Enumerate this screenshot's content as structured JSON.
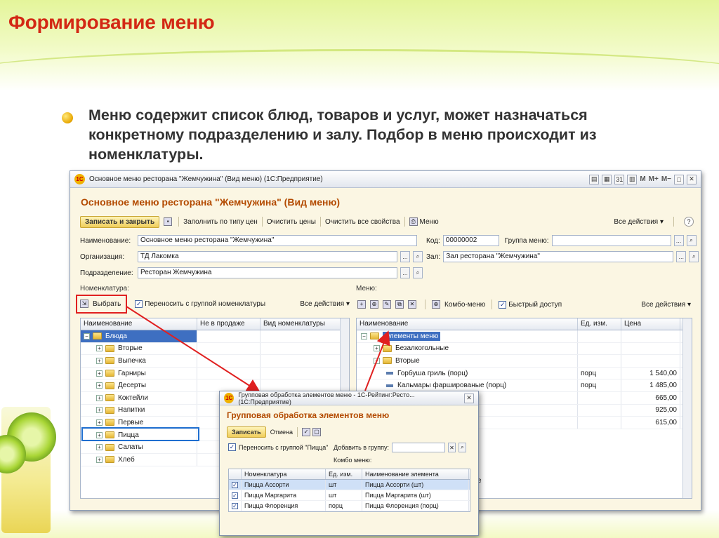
{
  "slide": {
    "title": "Формирование меню",
    "text": "Меню содержит список блюд, товаров и услуг, может назначаться конкретному подразделению и залу. Подбор в меню происходит из номенклатуры."
  },
  "window": {
    "title": "Основное меню ресторана \"Жемчужина\" (Вид меню)  (1С:Предприятие)",
    "logo": "1С",
    "title_buttons": [
      "M",
      "M+",
      "M−"
    ],
    "form_title": "Основное меню ресторана \"Жемчужина\" (Вид меню)",
    "toolbar": {
      "save_close": "Записать и закрыть",
      "fill_by_type": "Заполнить по типу цен",
      "clear_prices": "Очистить цены",
      "clear_props": "Очистить все свойства",
      "menu": "Меню",
      "all_actions": "Все действия ▾",
      "help": "?"
    },
    "fields": {
      "name_label": "Наименование:",
      "name_value": "Основное меню ресторана \"Жемчужина\"",
      "code_label": "Код:",
      "code_value": "00000002",
      "group_label": "Группа меню:",
      "group_value": "",
      "org_label": "Организация:",
      "org_value": "ТД Лакомка",
      "hall_label": "Зал:",
      "hall_value": "Зал ресторана \"Жемчужина\"",
      "dept_label": "Подразделение:",
      "dept_value": "Ресторан Жемчужина"
    },
    "left_pane": {
      "label": "Номенклатура:",
      "select_button": "Выбрать",
      "transfer_label": "Переносить с группой номенклатуры",
      "all_actions": "Все действия ▾",
      "columns": [
        "Наименование",
        "Не в продаже",
        "Вид номенклатуры"
      ],
      "rows": [
        {
          "name": "Блюда",
          "level": 0,
          "toggle": "−",
          "selected": true
        },
        {
          "name": "Вторые",
          "level": 1,
          "toggle": "+"
        },
        {
          "name": "Выпечка",
          "level": 1,
          "toggle": "+"
        },
        {
          "name": "Гарниры",
          "level": 1,
          "toggle": "+"
        },
        {
          "name": "Десерты",
          "level": 1,
          "toggle": "+"
        },
        {
          "name": "Коктейли",
          "level": 1,
          "toggle": "+"
        },
        {
          "name": "Напитки",
          "level": 1,
          "toggle": "+"
        },
        {
          "name": "Первые",
          "level": 1,
          "toggle": "+"
        },
        {
          "name": "Пицца",
          "level": 1,
          "toggle": "+"
        },
        {
          "name": "Салаты",
          "level": 1,
          "toggle": "+"
        },
        {
          "name": "Хлеб",
          "level": 1,
          "toggle": "+"
        }
      ]
    },
    "right_pane": {
      "label": "Меню:",
      "combo_menu": "Комбо-меню",
      "quick_access": "Быстрый доступ",
      "all_actions": "Все действия ▾",
      "columns": [
        "Наименование",
        "Ед. изм.",
        "Цена"
      ],
      "rows": [
        {
          "name": "Элементы меню",
          "type": "folder",
          "level": 0,
          "toggle": "−",
          "unit": "",
          "price": "",
          "selected": true
        },
        {
          "name": "Безалкогольные",
          "type": "folder",
          "level": 1,
          "toggle": "+",
          "unit": "",
          "price": ""
        },
        {
          "name": "Вторые",
          "type": "folder",
          "level": 1,
          "toggle": "−",
          "unit": "",
          "price": ""
        },
        {
          "name": "Горбуша гриль (порц)",
          "type": "item",
          "level": 2,
          "unit": "порц",
          "price": "1 540,00"
        },
        {
          "name": "Кальмары фаршированые (порц)",
          "type": "item",
          "level": 2,
          "unit": "порц",
          "price": "1 485,00"
        },
        {
          "name": "асами (порц)",
          "type": "item",
          "level": 2,
          "unit": "",
          "price": "665,00"
        },
        {
          "name": "",
          "type": "item",
          "level": 2,
          "unit": "",
          "price": "925,00"
        },
        {
          "name": "рц)",
          "type": "item",
          "level": 2,
          "unit": "",
          "price": "615,00"
        }
      ],
      "tail_text": "е"
    },
    "dialog": {
      "title": "Групповая обработка элементов меню - 1С-Рейтинг:Ресто... (1С:Предприятие)",
      "heading": "Групповая обработка элементов меню",
      "save": "Записать",
      "cancel": "Отмена",
      "transfer_label": "Переносить с группой \"Пицца\"",
      "add_to_group": "Добавить в группу:",
      "combo_menu": "Комбо меню:",
      "columns": [
        "Номенклатура",
        "Ед. изм.",
        "Наименование элемента"
      ],
      "rows": [
        {
          "item": "Пицца Ассорти",
          "unit": "шт",
          "name": "Пицца Ассорти (шт)",
          "selected": true
        },
        {
          "item": "Пицца Маргарита",
          "unit": "шт",
          "name": "Пицца Маргарита (шт)"
        },
        {
          "item": "Пицца Флоренция",
          "unit": "порц",
          "name": "Пицца Флоренция (порц)"
        }
      ]
    }
  },
  "colors": {
    "title_red": "#d32814",
    "form_title": "#b34a00",
    "selection": "#3e6fc1",
    "highlight_red": "#e02020",
    "highlight_blue": "#1f6fd0"
  }
}
